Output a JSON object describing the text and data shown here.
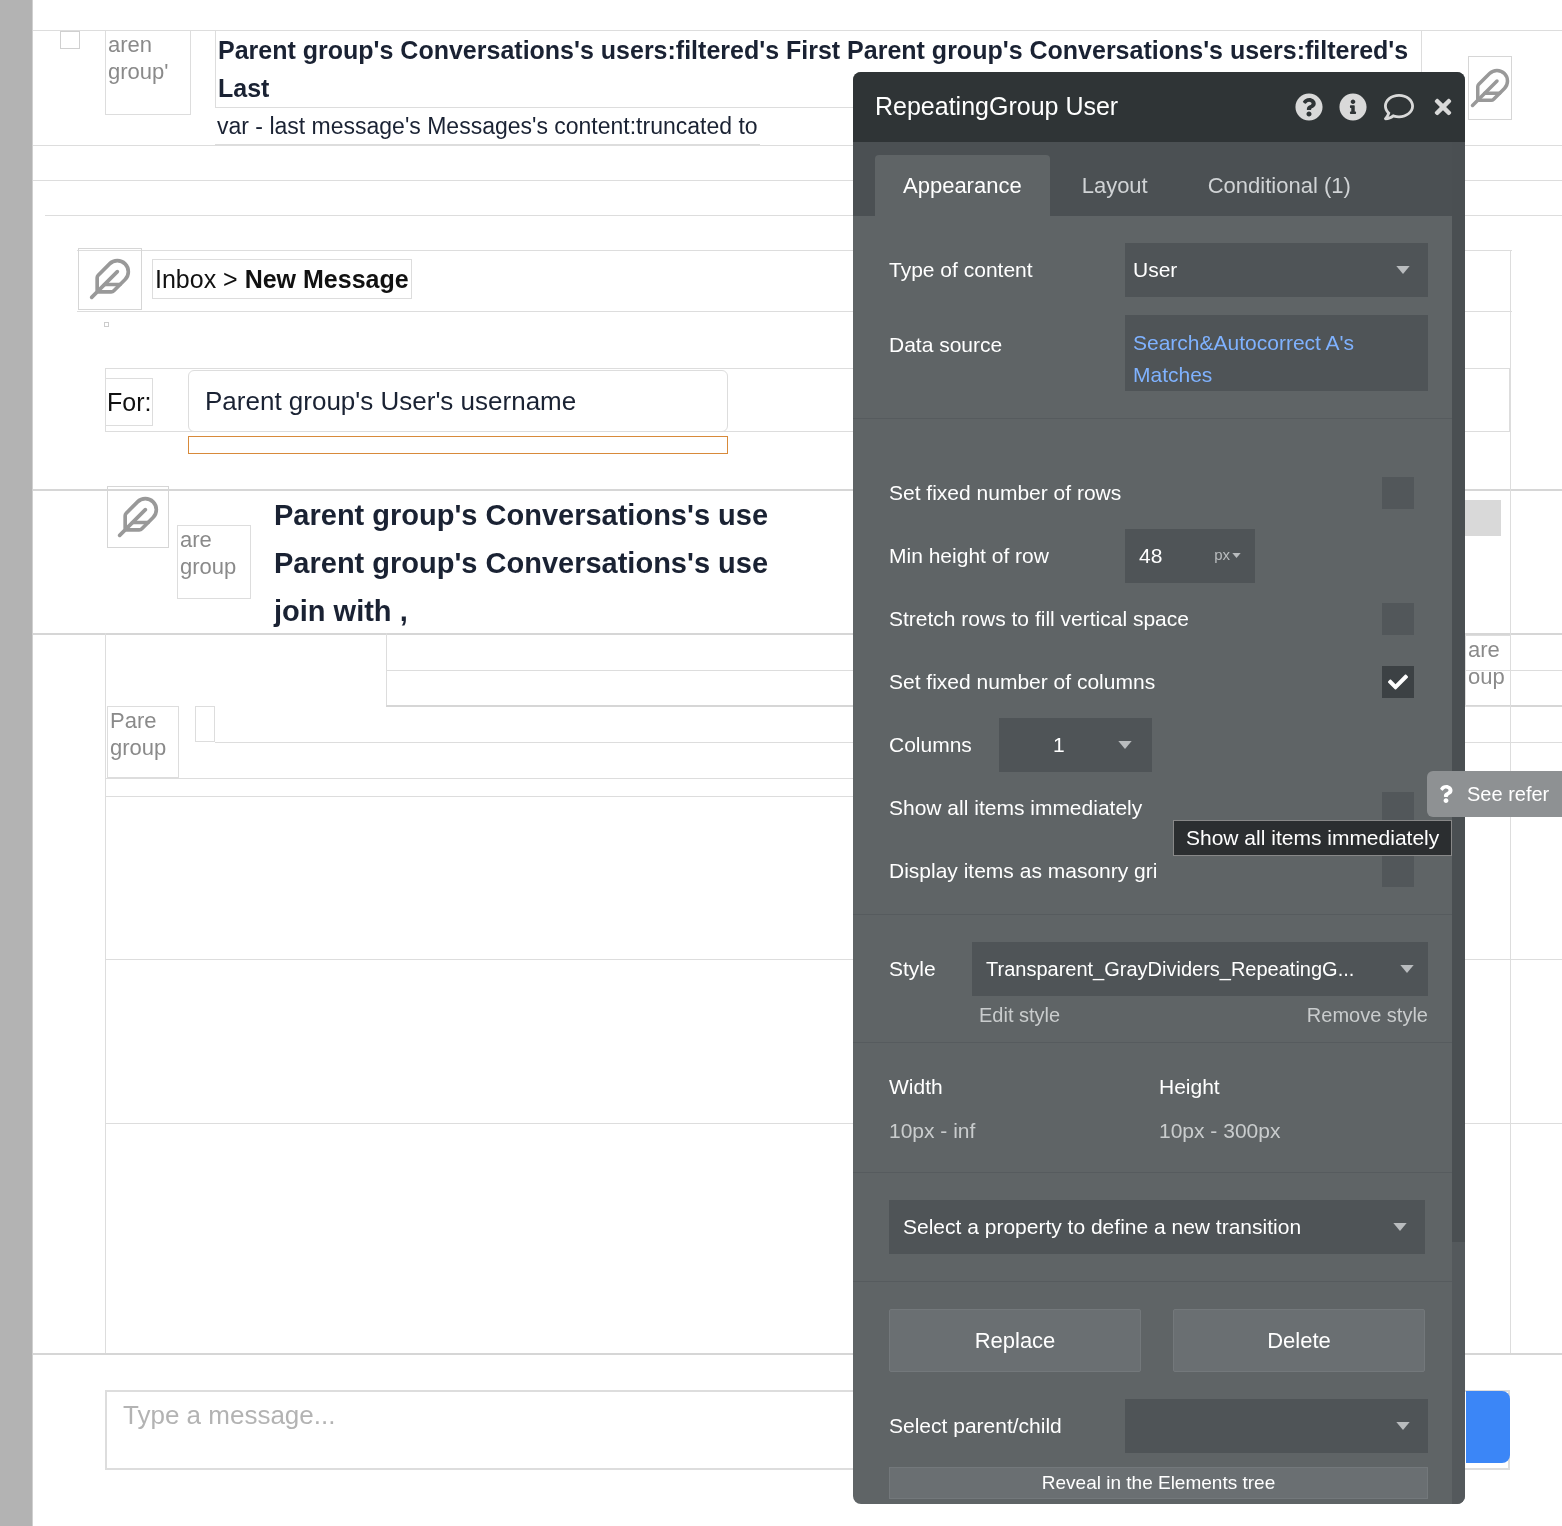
{
  "canvas": {
    "conversation": {
      "checkbox": {
        "checked": false
      },
      "image_text": "aren group'",
      "title": "Parent group's Conversations's users:filtered's First Parent group's Conversations's users:filtered's Last",
      "preview": "var - last message's Messages's content:truncated to"
    },
    "breadcrumb": {
      "parent": "Inbox >",
      "current": "New Message"
    },
    "recipient": {
      "label": "For:",
      "value": "Parent group's User's username"
    },
    "header_row": {
      "image_text": "are group",
      "lines": [
        "Parent group's Conversations's use",
        "Parent group's Conversations's use",
        "join with ,"
      ]
    },
    "message_images": [
      {
        "text": "Pare group"
      }
    ],
    "right_images": [
      {
        "text": "are oup"
      }
    ],
    "message_input": {
      "placeholder": "Type a message..."
    }
  },
  "panel": {
    "title": "RepeatingGroup User",
    "tabs": [
      {
        "label": "Appearance",
        "selected": true
      },
      {
        "label": "Layout",
        "selected": false
      },
      {
        "label": "Conditional (1)",
        "selected": false
      }
    ],
    "type_of_content": {
      "label": "Type of content",
      "value": "User"
    },
    "data_source": {
      "label": "Data source",
      "value": "Search&Autocorrect A's Matches"
    },
    "settings": [
      {
        "kind": "checkbox",
        "label": "Set fixed number of rows",
        "checked": false
      },
      {
        "kind": "number",
        "label": "Min height of row",
        "value": "48",
        "unit": "px"
      },
      {
        "kind": "checkbox",
        "label": "Stretch rows to fill vertical space",
        "checked": false
      },
      {
        "kind": "checkbox",
        "label": "Set fixed number of columns",
        "checked": true
      },
      {
        "kind": "dropdown",
        "label": "Columns",
        "value": "1"
      },
      {
        "kind": "checkbox",
        "label": "Show all items immediately",
        "checked": false
      },
      {
        "kind": "checkbox",
        "label": "Display items as masonry gri",
        "checked": false
      }
    ],
    "style": {
      "label": "Style",
      "value": "Transparent_GrayDividers_RepeatingG...",
      "edit": "Edit style",
      "remove": "Remove style"
    },
    "size": [
      {
        "label": "Width",
        "value": "10px - inf"
      },
      {
        "label": "Height",
        "value": "10px - 300px"
      }
    ],
    "transition": "Select a property to define a new transition",
    "buttons": [
      "Replace",
      "Delete"
    ],
    "parent_child": {
      "label": "Select parent/child"
    },
    "reveal": "Reveal in the Elements tree"
  },
  "tooltip": "Show all items immediately",
  "reference_button": "See refer"
}
